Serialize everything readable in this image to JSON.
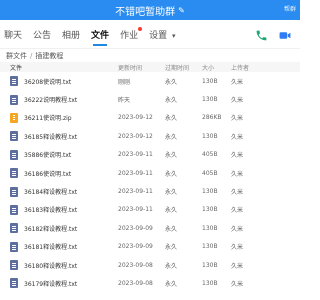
{
  "title": "不错吧暂助群",
  "corner_text": "帮群",
  "tabs": [
    {
      "label": "聊天"
    },
    {
      "label": "公告"
    },
    {
      "label": "相册"
    },
    {
      "label": "文件"
    },
    {
      "label": "作业"
    },
    {
      "label": "设置"
    }
  ],
  "breadcrumb": {
    "root": "群文件",
    "separator": "/",
    "current": "插建教程"
  },
  "columns": {
    "name": "文件",
    "updated": "更新时间",
    "expire": "过期时间",
    "size": "大小",
    "uploader": "上传者"
  },
  "files": [
    {
      "name": "36208使说明.txt",
      "updated": "刚刚",
      "expire": "永久",
      "size": "130B",
      "uploader": "久米",
      "type": "txt"
    },
    {
      "name": "36222说明教程.txt",
      "updated": "昨天",
      "expire": "永久",
      "size": "130B",
      "uploader": "久米",
      "type": "txt"
    },
    {
      "name": "36211使说明.zip",
      "updated": "2023-09-12",
      "expire": "永久",
      "size": "286KB",
      "uploader": "久米",
      "type": "zip"
    },
    {
      "name": "36185释设教程.txt",
      "updated": "2023-09-12",
      "expire": "永久",
      "size": "130B",
      "uploader": "久米",
      "type": "txt"
    },
    {
      "name": "35886使说明.txt",
      "updated": "2023-09-11",
      "expire": "永久",
      "size": "405B",
      "uploader": "久米",
      "type": "txt"
    },
    {
      "name": "36186使说明.txt",
      "updated": "2023-09-11",
      "expire": "永久",
      "size": "405B",
      "uploader": "久米",
      "type": "txt"
    },
    {
      "name": "36184释设教程.txt",
      "updated": "2023-09-11",
      "expire": "永久",
      "size": "130B",
      "uploader": "久米",
      "type": "txt"
    },
    {
      "name": "36183释设教程.txt",
      "updated": "2023-09-11",
      "expire": "永久",
      "size": "130B",
      "uploader": "久米",
      "type": "txt"
    },
    {
      "name": "36182释设教程.txt",
      "updated": "2023-09-09",
      "expire": "永久",
      "size": "130B",
      "uploader": "久米",
      "type": "txt"
    },
    {
      "name": "36181释设教程.txt",
      "updated": "2023-09-09",
      "expire": "永久",
      "size": "130B",
      "uploader": "久米",
      "type": "txt"
    },
    {
      "name": "36180释设教程.txt",
      "updated": "2023-09-08",
      "expire": "永久",
      "size": "130B",
      "uploader": "久米",
      "type": "txt"
    },
    {
      "name": "36179释设教程.txt",
      "updated": "2023-09-08",
      "expire": "永久",
      "size": "130B",
      "uploader": "久米",
      "type": "txt"
    }
  ],
  "colors": {
    "titlebar": "#2a8cf0",
    "accent": "#1e88e5",
    "phone": "#19a974",
    "video": "#2f7cf6",
    "badge": "#ff3b30",
    "txt_icon": "#5c6f9e",
    "zip_icon": "#f5a623"
  },
  "icons": {
    "title_edit": "pencil-icon",
    "settings_chevron": "chevron-down-icon",
    "phone": "phone-icon",
    "video": "video-icon",
    "file_txt": "text-file-icon",
    "file_zip": "zip-file-icon"
  }
}
